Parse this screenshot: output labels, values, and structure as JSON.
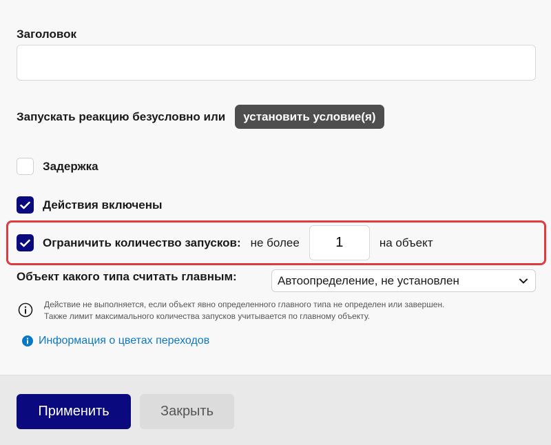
{
  "form": {
    "title_label": "Заголовок",
    "title_value": "",
    "condition_text": "Запускать реакцию безусловно или",
    "condition_button": "установить условие(я)",
    "delay_label": "Задержка",
    "delay_checked": false,
    "actions_label": "Действия включены",
    "actions_checked": true,
    "limit": {
      "label": "Ограничить количество запусков:",
      "checked": true,
      "prefix": "не более",
      "value": "1",
      "suffix": "на объект"
    },
    "main_type_label": "Объект какого типа считать главным:",
    "main_type_value": "Автоопределение, не установлен",
    "note_line1": "Действие не выполняется, если объект явно определенного главного типа не определен или завершен.",
    "note_line2": "Также лимит максимального количества запусков учитывается по главному объекту.",
    "link_text": "Информация о цветах переходов"
  },
  "footer": {
    "apply": "Применить",
    "close": "Закрыть"
  },
  "colors": {
    "primary": "#0a0a7e",
    "highlight": "#e0393e",
    "link": "#0b78c5"
  }
}
